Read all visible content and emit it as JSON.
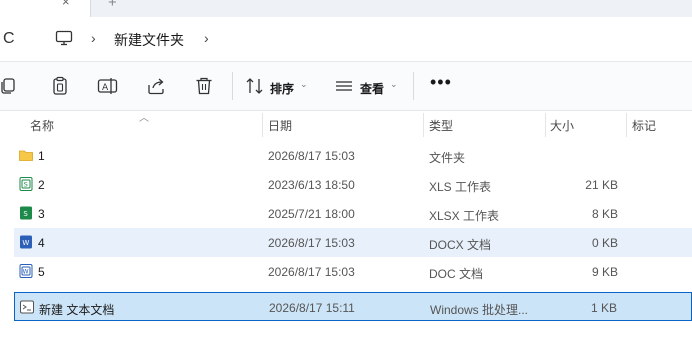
{
  "tabs": {
    "close_glyph": "×",
    "add_glyph": "+"
  },
  "address": {
    "refresh_glyph": "C",
    "separator": "›",
    "path": [
      "新建文件夹"
    ]
  },
  "toolbar": {
    "sort_label": "排序",
    "view_label": "查看",
    "more_label": "•••",
    "caret": "⌄",
    "icons": [
      "copy-icon",
      "paste-icon",
      "rename-icon",
      "share-icon",
      "delete-icon",
      "sort-icon",
      "view-icon"
    ]
  },
  "columns": {
    "name": "名称",
    "date": "日期",
    "type": "类型",
    "size": "大小",
    "tags": "标记"
  },
  "files": [
    {
      "name": "1",
      "date": "2026/8/17 15:03",
      "type": "文件夹",
      "size": "",
      "icon": "folder-icon",
      "state": "normal"
    },
    {
      "name": "2",
      "date": "2023/6/13 18:50",
      "type": "XLS 工作表",
      "size": "21 KB",
      "icon": "xls-file-icon",
      "state": "normal"
    },
    {
      "name": "3",
      "date": "2025/7/21 18:00",
      "type": "XLSX 工作表",
      "size": "8 KB",
      "icon": "xlsx-file-icon",
      "state": "normal"
    },
    {
      "name": "4",
      "date": "2026/8/17 15:03",
      "type": "DOCX 文档",
      "size": "0 KB",
      "icon": "docx-file-icon",
      "state": "hover"
    },
    {
      "name": "5",
      "date": "2026/8/17 15:03",
      "type": "DOC 文档",
      "size": "9 KB",
      "icon": "doc-file-icon",
      "state": "normal"
    },
    {
      "name": "新建 文本文档",
      "date": "2026/8/17 15:11",
      "type": "Windows 批处理...",
      "size": "1 KB",
      "icon": "batch-file-icon",
      "state": "selected"
    }
  ],
  "colors": {
    "selected_bg": "#cce4f7",
    "selected_border": "#0a64c8",
    "hover_bg": "#e8f1fb",
    "folder": "#f7c748",
    "word": "#2b5fb8",
    "excel": "#1e8a4a"
  }
}
